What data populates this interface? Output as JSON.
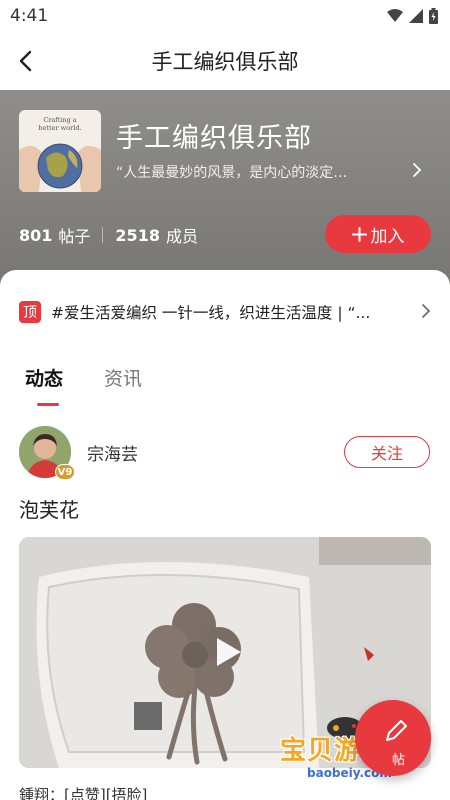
{
  "status_bar": {
    "time": "4:41"
  },
  "nav": {
    "title": "手工编织俱乐部"
  },
  "group": {
    "cover_text": "Crafting a\nbetter world.",
    "name": "手工编织俱乐部",
    "quote": "“人生最曼妙的风景，是内心的淡定…",
    "posts_count": "801",
    "posts_label": "帖子",
    "members_count": "2518",
    "members_label": "成员",
    "join_label": "加入"
  },
  "pinned": {
    "badge": "顶",
    "text": "#爱生活爱编织  一针一线，织进生活温度 | “..."
  },
  "tabs": [
    {
      "label": "动态"
    },
    {
      "label": "资讯"
    }
  ],
  "post": {
    "author": "宗海芸",
    "level": "V9",
    "follow_label": "关注",
    "title": "泡芙花",
    "comment_preview": "鍾翔：[点赞][捂脸]"
  },
  "fab": {
    "label": "帖"
  },
  "watermark": {
    "text": "宝贝游戏网",
    "url": "baobeiy.com"
  },
  "colors": {
    "accent": "#e8393f",
    "header_bg": "#8f8e8b"
  }
}
